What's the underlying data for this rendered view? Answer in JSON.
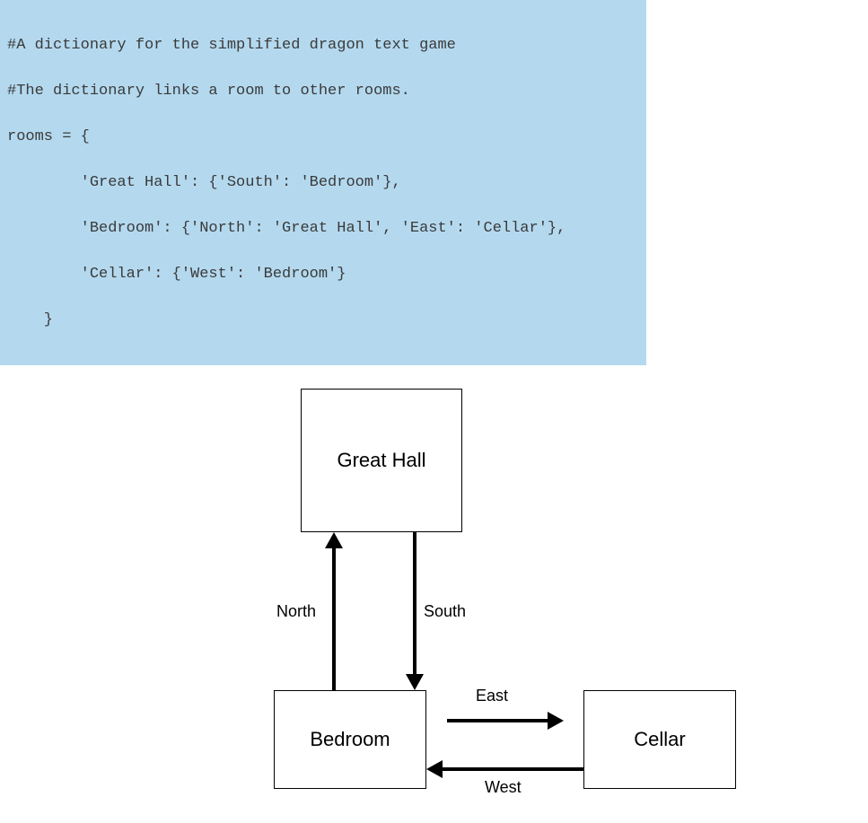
{
  "code": {
    "line1": "#A dictionary for the simplified dragon text game",
    "line2": "#The dictionary links a room to other rooms.",
    "line3": "rooms = {",
    "line4": "        'Great Hall': {'South': 'Bedroom'},",
    "line5": "        'Bedroom': {'North': 'Great Hall', 'East': 'Cellar'},",
    "line6": "        'Cellar': {'West': 'Bedroom'}",
    "line7": "    }"
  },
  "rooms": {
    "great_hall": "Great Hall",
    "bedroom": "Bedroom",
    "cellar": "Cellar"
  },
  "labels": {
    "north": "North",
    "south": "South",
    "east": "East",
    "west": "West"
  },
  "graph": {
    "nodes": [
      "Great Hall",
      "Bedroom",
      "Cellar"
    ],
    "edges": [
      {
        "from": "Great Hall",
        "to": "Bedroom",
        "direction": "South"
      },
      {
        "from": "Bedroom",
        "to": "Great Hall",
        "direction": "North"
      },
      {
        "from": "Bedroom",
        "to": "Cellar",
        "direction": "East"
      },
      {
        "from": "Cellar",
        "to": "Bedroom",
        "direction": "West"
      }
    ]
  }
}
